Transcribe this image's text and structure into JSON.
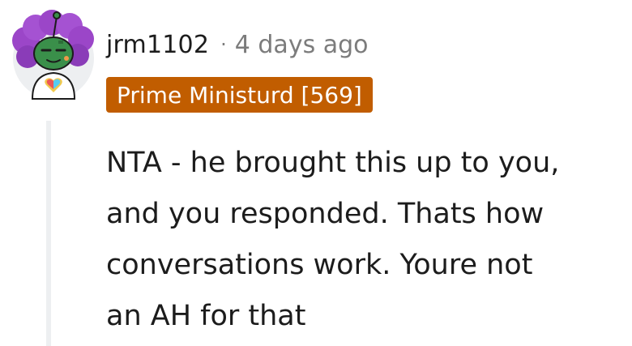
{
  "comment": {
    "author": "jrm1102",
    "separator": "·",
    "time_ago": "4 days ago",
    "flair": {
      "text": "Prime Ministurd [569]",
      "background": "#c15d00",
      "text_color": "#ffffff"
    },
    "body_lines": [
      "NTA - he brought this up to you,",
      "and you responded. Thats how",
      "conversations work. Youre not",
      "an AH for that"
    ]
  },
  "avatar": {
    "icon": "snoo-avatar-icon",
    "hair_color": "#9b46c8",
    "skin_color": "#3a8f4a",
    "accessory_icon": "rainbow-heart-icon"
  },
  "colors": {
    "text": "#1c1c1c",
    "muted": "#7c7c7c",
    "thread_line": "#edeff1"
  }
}
